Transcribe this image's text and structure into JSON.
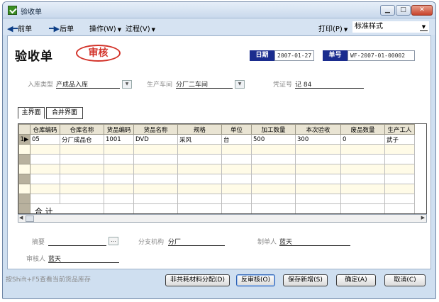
{
  "window": {
    "title": "验收单"
  },
  "toolbar": {
    "prev": "前单",
    "next": "后单",
    "operate": "操作(W)",
    "process": "过程(V)",
    "print": "打印(P)",
    "style_value": "标准样式"
  },
  "header": {
    "doc_title": "验收单",
    "stamp": "审核",
    "date_label": "日期",
    "date_value": "2007-01-27",
    "no_label": "单号",
    "no_value": "WF-2007-01-00002"
  },
  "fields": {
    "instock_type_label": "入库类型",
    "instock_type_value": "产成品入库",
    "workshop_label": "生产车间",
    "workshop_value": "分厂二车间",
    "voucher_label": "凭证号",
    "voucher_value": "记 84"
  },
  "tabs": [
    "主界面",
    "合并界面"
  ],
  "grid": {
    "columns": [
      "仓库编码",
      "仓库名称",
      "货品编码",
      "货品名称",
      "规格",
      "单位",
      "加工数量",
      "本次验收",
      "废品数量",
      "生产工人"
    ],
    "rows": [
      {
        "marker": "1▶",
        "cells": [
          "05",
          "分厂成品仓",
          "1001",
          "DVD",
          "采风",
          "台",
          "500",
          "300",
          "0",
          "武子"
        ]
      }
    ],
    "total_label": "合 计"
  },
  "footer": {
    "summary_label": "摘要",
    "summary_value": "",
    "branch_label": "分支机构",
    "branch_value": "分厂",
    "maker_label": "制单人",
    "maker_value": "蓝天",
    "auditor_label": "审核人",
    "auditor_value": "蓝天"
  },
  "status_hint": "按Shift+F5查看当前货品库存",
  "buttons": {
    "non_shared": "非共耗材料分配(D)",
    "unaudit": "反审核(O)",
    "save_new": "保存新增(S)",
    "ok": "确定(A)",
    "cancel": "取消(C)"
  }
}
